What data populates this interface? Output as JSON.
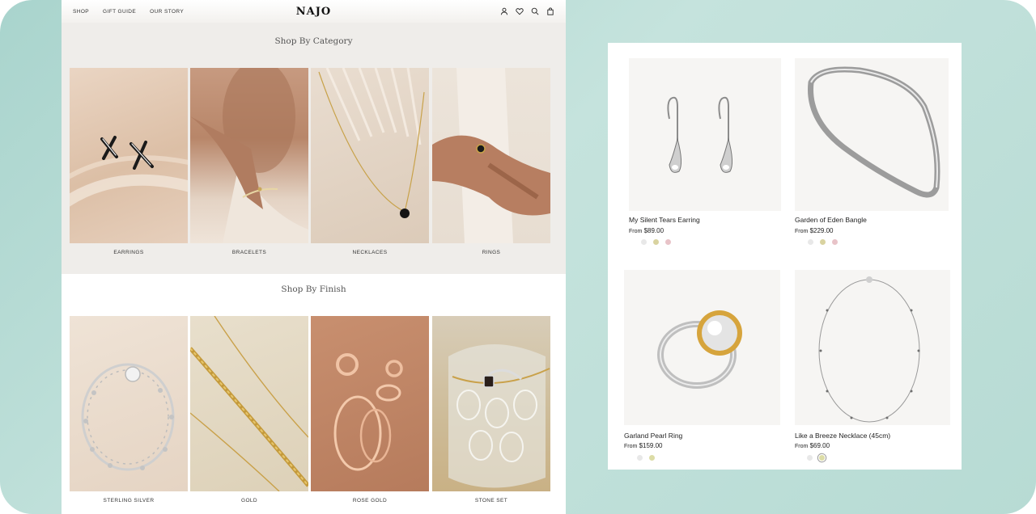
{
  "nav": {
    "links": [
      "SHOP",
      "GIFT GUIDE",
      "OUR STORY"
    ],
    "logo": "NAJO",
    "icons": [
      "account-icon",
      "wishlist-icon",
      "search-icon",
      "cart-icon"
    ]
  },
  "category_section": {
    "title": "Shop By Category",
    "items": [
      {
        "label": "EARRINGS"
      },
      {
        "label": "BRACELETS"
      },
      {
        "label": "NECKLACES"
      },
      {
        "label": "RINGS"
      }
    ]
  },
  "finish_section": {
    "title": "Shop By Finish",
    "items": [
      {
        "label": "STERLING SILVER"
      },
      {
        "label": "GOLD"
      },
      {
        "label": "ROSE GOLD"
      },
      {
        "label": "STONE SET"
      }
    ]
  },
  "products": [
    {
      "name": "My Silent Tears Earring",
      "from": "From",
      "price": "$89.00",
      "swatches": [
        "#e8e8e8",
        "#d9d3a0",
        "#e8c3c8"
      ]
    },
    {
      "name": "Garden of Eden Bangle",
      "from": "From",
      "price": "$229.00",
      "swatches": [
        "#e8e8e8",
        "#d9d3a0",
        "#e8c3c8"
      ]
    },
    {
      "name": "Garland Pearl Ring",
      "from": "From",
      "price": "$159.00",
      "swatches": [
        "#e8e8e8",
        "#dcdca6"
      ]
    },
    {
      "name": "Like a Breeze Necklace (45cm)",
      "from": "From",
      "price": "$69.00",
      "swatches": [
        "#e8e8e8",
        "#dcdca6"
      ]
    }
  ],
  "colors": {
    "background": "#b7dbd4",
    "category_bg": "#efedea",
    "product_image_bg": "#f6f5f3",
    "silver_swatch": "#e8e8e8",
    "gold_swatch": "#d9d3a0",
    "rose_swatch": "#e8c3c8"
  }
}
